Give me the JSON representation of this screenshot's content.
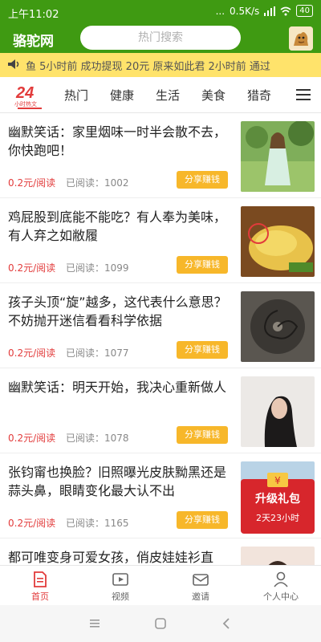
{
  "status": {
    "time": "上午11:02",
    "dots": "...",
    "speed": "0.5K/s",
    "battery": "40"
  },
  "header": {
    "logo": "骆驼网",
    "search_placeholder": "热门搜索"
  },
  "ticker": {
    "text": "鱼 5小时前 成功提现 20元     原来如此君 2小时前 通过"
  },
  "tabs": {
    "badge": "24",
    "badge_sub": "小时热文",
    "items": [
      "热门",
      "健康",
      "生活",
      "美食",
      "猎奇"
    ]
  },
  "articles": [
    {
      "title": "幽默笑话：家里烟味一时半会散不去，你快跑吧！",
      "price": "0.2元/阅读",
      "reads": "已阅读：1002",
      "share": "分享赚钱",
      "thumb": "photo-woman-garden"
    },
    {
      "title": "鸡屁股到底能不能吃？有人奉为美味，有人弃之如敝履",
      "price": "0.2元/阅读",
      "reads": "已阅读：1099",
      "share": "分享赚钱",
      "thumb": "photo-chicken"
    },
    {
      "title": "孩子头顶“旋”越多，这代表什么意思？不妨抛开迷信看看科学依据",
      "price": "0.2元/阅读",
      "reads": "已阅读：1077",
      "share": "分享赚钱",
      "thumb": "photo-hair-whorl"
    },
    {
      "title": "幽默笑话：明天开始，我决心重新做人",
      "price": "0.2元/阅读",
      "reads": "已阅读：1078",
      "share": "分享赚钱",
      "thumb": "photo-woman-portrait"
    },
    {
      "title": "张钧甯也换脸？旧照曝光皮肤黝黑还是蒜头鼻，眼睛变化最大认不出",
      "price": "0.2元/阅读",
      "reads": "已阅读：1165",
      "share": "分享赚钱",
      "thumb": "photo-actress"
    },
    {
      "title": "都可唯变身可爱女孩，俏皮娃娃衫直",
      "price": "",
      "reads": "",
      "share": "",
      "thumb": "photo-girl"
    }
  ],
  "promo": {
    "title": "升级礼包",
    "countdown": "2天23小时"
  },
  "tabbar": {
    "items": [
      "首页",
      "视频",
      "邀请",
      "个人中心"
    ]
  },
  "colors": {
    "brand_green": "#3f9a12",
    "accent_red": "#e23b3b",
    "share_orange": "#f7b72a",
    "ticker_yellow": "#ffe36b"
  }
}
